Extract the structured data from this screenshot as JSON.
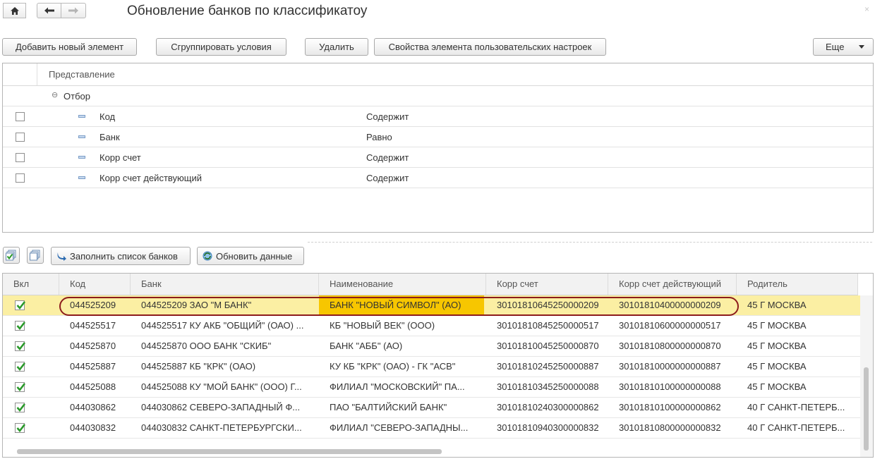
{
  "window": {
    "title": "Обновление банков по классификатоу",
    "close_glyph": "×"
  },
  "nav": {
    "home_icon": "home-icon",
    "back_icon": "arrow-left-icon",
    "forward_icon": "arrow-right-icon"
  },
  "toolbar": {
    "add_label": "Добавить новый элемент",
    "group_label": "Сгруппировать условия",
    "delete_label": "Удалить",
    "props_label": "Свойства элемента пользовательских настроек",
    "more_label": "Еще"
  },
  "filter": {
    "header": "Представление",
    "group_label": "Отбор",
    "group_toggle": "⊖",
    "items": [
      {
        "field": "Код",
        "condition": "Содержит"
      },
      {
        "field": "Банк",
        "condition": "Равно"
      },
      {
        "field": "Корр счет",
        "condition": "Содержит"
      },
      {
        "field": "Корр счет действующий",
        "condition": "Содержит"
      }
    ]
  },
  "grid_toolbar": {
    "fill_label": "Заполнить список банков",
    "refresh_label": "Обновить данные"
  },
  "grid": {
    "columns": [
      "Вкл",
      "Код",
      "Банк",
      "Наименование",
      "Корр счет",
      "Корр счет действующий",
      "Родитель"
    ],
    "rows": [
      {
        "checked": true,
        "code": "044525209",
        "bank": "044525209 ЗАО \"М БАНК\"",
        "name": "БАНК \"НОВЫЙ СИМВОЛ\" (АО)",
        "corr": "30101810645250000209",
        "corr_active": "30101810400000000209",
        "parent": "45 Г МОСКВА"
      },
      {
        "checked": true,
        "code": "044525517",
        "bank": "044525517 КУ АКБ \"ОБЩИЙ\" (ОАО) ...",
        "name": "КБ \"НОВЫЙ ВЕК\" (ООО)",
        "corr": "30101810845250000517",
        "corr_active": "30101810600000000517",
        "parent": "45 Г МОСКВА"
      },
      {
        "checked": true,
        "code": "044525870",
        "bank": "044525870 ООО БАНК \"СКИБ\"",
        "name": "БАНК \"АББ\" (АО)",
        "corr": "30101810045250000870",
        "corr_active": "30101810800000000870",
        "parent": "45 Г МОСКВА"
      },
      {
        "checked": true,
        "code": "044525887",
        "bank": "044525887 КБ \"КРК\" (ОАО)",
        "name": "КУ КБ \"КРК\" (ОАО) - ГК \"АСВ\"",
        "corr": "30101810245250000887",
        "corr_active": "30101810000000000887",
        "parent": "45 Г МОСКВА"
      },
      {
        "checked": true,
        "code": "044525088",
        "bank": "044525088 КУ \"МОЙ БАНК\" (ООО) Г...",
        "name": "ФИЛИАЛ \"МОСКОВСКИЙ\" ПА...",
        "corr": "30101810345250000088",
        "corr_active": "30101810100000000088",
        "parent": "45 Г МОСКВА"
      },
      {
        "checked": true,
        "code": "044030862",
        "bank": "044030862 СЕВЕРО-ЗАПАДНЫЙ Ф...",
        "name": "ПАО \"БАЛТИЙСКИЙ БАНК\"",
        "corr": "30101810240300000862",
        "corr_active": "30101810100000000862",
        "parent": "40 Г САНКТ-ПЕТЕРБ..."
      },
      {
        "checked": true,
        "code": "044030832",
        "bank": "044030832 САНКТ-ПЕТЕРБУРГСКИ...",
        "name": "ФИЛИАЛ \"СЕВЕРО-ЗАПАДНЫ...",
        "corr": "30101810940300000832",
        "corr_active": "30101810800000000832",
        "parent": "40 Г САНКТ-ПЕТЕРБ..."
      }
    ]
  },
  "colors": {
    "selected_row": "#fbefa3",
    "highlight_cell": "#f7c600",
    "annotation_oval": "#8c1c1c",
    "check_green": "#2a9a2a"
  }
}
